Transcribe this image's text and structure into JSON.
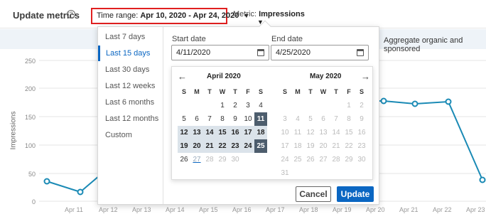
{
  "header": {
    "title": "Update metrics",
    "time_range_label": "Time range:",
    "time_range_value": "Apr 10, 2020 - Apr 24, 2020",
    "metric_label": "Metric:",
    "metric_value": "Impressions"
  },
  "aggregate_label": "Aggregate organic and sponsored",
  "chart": {
    "ylabel": "Impressions",
    "yticks": [
      "250",
      "200",
      "150",
      "100",
      "50",
      "0"
    ],
    "xticks": [
      "Apr 11",
      "Apr 12",
      "Apr 13",
      "Apr 14",
      "Apr 15",
      "Apr 16",
      "Apr 17",
      "Apr 18",
      "Apr 19",
      "Apr 20",
      "Apr 21",
      "Apr 22",
      "Apr 23"
    ],
    "line_color": "#1a8ab5"
  },
  "presets": [
    "Last 7 days",
    "Last 15 days",
    "Last 30 days",
    "Last 12 weeks",
    "Last 6 months",
    "Last 12 months",
    "Custom"
  ],
  "active_preset": "Last 15 days",
  "start_date_label": "Start date",
  "start_date": "4/11/2020",
  "end_date_label": "End date",
  "end_date": "4/25/2020",
  "calendar": {
    "left_month": "April 2020",
    "right_month": "May 2020",
    "dow": [
      "S",
      "M",
      "T",
      "W",
      "T",
      "F",
      "S"
    ]
  },
  "buttons": {
    "cancel": "Cancel",
    "update": "Update"
  },
  "colors": {
    "accent": "#0a66c2",
    "highlight": "#e02020",
    "range": "#dbe3ea",
    "range_end": "#4d5d6d"
  }
}
